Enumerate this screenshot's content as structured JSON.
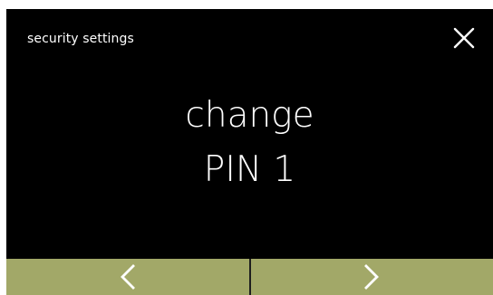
{
  "header": {
    "title": "security settings",
    "close_icon": "close-icon"
  },
  "main": {
    "line1": "change",
    "line2": "PIN 1"
  },
  "footer": {
    "prev_icon": "chevron-left-icon",
    "next_icon": "chevron-right-icon"
  },
  "colors": {
    "background": "#000000",
    "text": "#ffffff",
    "footer_bar": "#a2a868",
    "divider": "#1e1e1e"
  }
}
